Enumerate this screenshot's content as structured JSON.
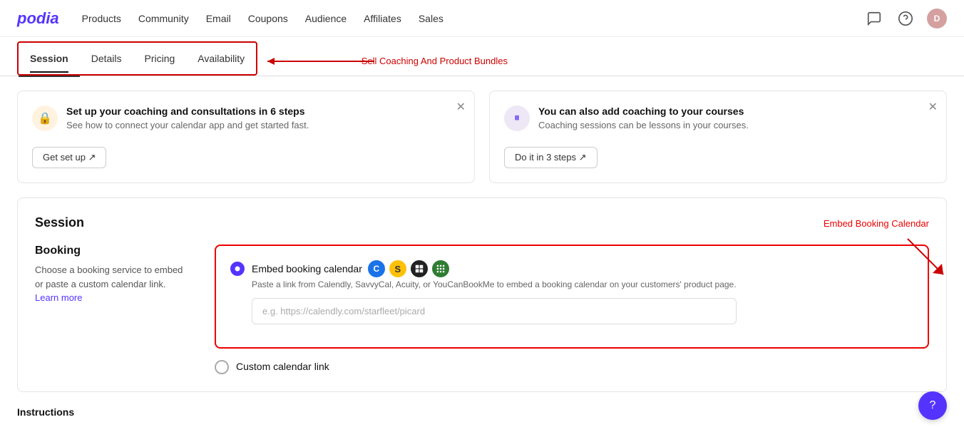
{
  "logo": "podia",
  "nav": {
    "items": [
      {
        "label": "Products",
        "id": "products"
      },
      {
        "label": "Community",
        "id": "community"
      },
      {
        "label": "Email",
        "id": "email"
      },
      {
        "label": "Coupons",
        "id": "coupons"
      },
      {
        "label": "Audience",
        "id": "audience"
      },
      {
        "label": "Affiliates",
        "id": "affiliates"
      },
      {
        "label": "Sales",
        "id": "sales"
      }
    ]
  },
  "header_icons": {
    "chat_icon": "💬",
    "help_icon": "?",
    "avatar_initial": "D"
  },
  "tabs": [
    {
      "label": "Session",
      "id": "session",
      "active": true
    },
    {
      "label": "Details",
      "id": "details",
      "active": false
    },
    {
      "label": "Pricing",
      "id": "pricing",
      "active": false
    },
    {
      "label": "Availability",
      "id": "availability",
      "active": false
    }
  ],
  "sell_bundle_text": "Sell Coaching And Product Bundles",
  "info_cards": [
    {
      "icon": "🔒",
      "icon_class": "icon-orange",
      "title": "Set up your coaching and consultations in 6 steps",
      "description": "See how to connect your calendar app and get started fast.",
      "button_label": "Get set up ↗"
    },
    {
      "icon": "⏸",
      "icon_class": "icon-purple",
      "title": "You can also add coaching to your courses",
      "description": "Coaching sessions can be lessons in your courses.",
      "button_label": "Do it in 3 steps ↗"
    }
  ],
  "session": {
    "title": "Session",
    "embed_link_label": "Embed Booking Calendar",
    "booking": {
      "title": "Booking",
      "description": "Choose a booking service to embed or paste a custom calendar link.",
      "learn_more": "Learn more"
    },
    "embed_option": {
      "label": "Embed booking calendar",
      "description": "Paste a link from Calendly, SavvyCal, Acuity, or YouCanBookMe to embed a booking calendar on your customers' product page.",
      "placeholder": "e.g. https://calendly.com/starfleet/picard",
      "calendar_icons": [
        {
          "label": "C",
          "color": "cal-blue"
        },
        {
          "label": "S",
          "color": "cal-yellow"
        },
        {
          "label": "◈",
          "color": "cal-dark"
        },
        {
          "label": "▦",
          "color": "cal-green"
        }
      ]
    },
    "custom_option": {
      "label": "Custom calendar link"
    }
  },
  "footer_section_label": "Instructions",
  "help_icon": "?"
}
